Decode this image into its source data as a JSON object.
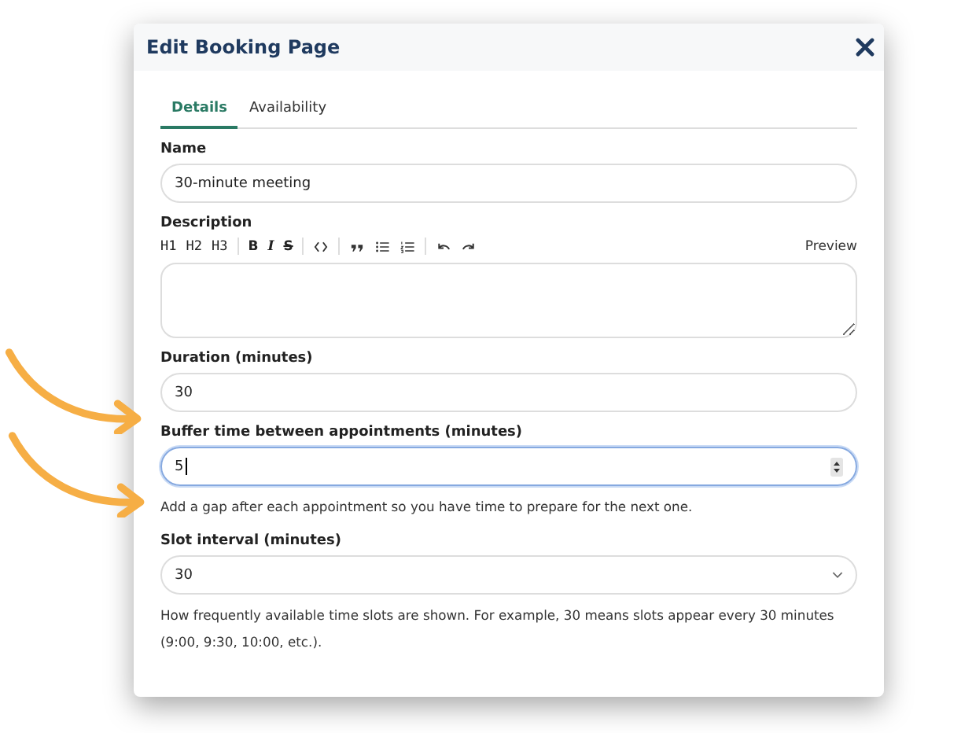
{
  "dialog": {
    "title": "Edit Booking Page"
  },
  "tabs": [
    {
      "label": "Details",
      "selected": true
    },
    {
      "label": "Availability",
      "selected": false
    }
  ],
  "fields": [
    {
      "kind": "text",
      "label": "Name",
      "value": "30-minute meeting",
      "focused": false
    },
    {
      "kind": "editor",
      "label": "Description",
      "preview": "Preview",
      "toolbar": [
        [
          {
            "kind": "text",
            "text": "H1"
          },
          {
            "kind": "text",
            "text": "H2"
          },
          {
            "kind": "text",
            "text": "H3"
          }
        ],
        [
          {
            "kind": "bold",
            "text": "B"
          },
          {
            "kind": "italic",
            "text": "I"
          },
          {
            "kind": "strike",
            "text": "S"
          }
        ],
        [
          {
            "kind": "code"
          }
        ],
        [
          {
            "kind": "quote"
          },
          {
            "kind": "bullets"
          },
          {
            "kind": "numbers"
          }
        ],
        [
          {
            "kind": "undo"
          },
          {
            "kind": "redo"
          }
        ]
      ]
    },
    {
      "kind": "number",
      "label": "Duration (minutes)",
      "value": "30",
      "focused": false
    },
    {
      "kind": "number",
      "label": "Buffer time between appointments (minutes)",
      "value": "5",
      "focused": true,
      "help": "Add a gap after each appointment so you have time to prepare for the next one."
    },
    {
      "kind": "select",
      "label": "Slot interval (minutes)",
      "value": "30",
      "focused": false,
      "help": "How frequently available time slots are shown. For example, 30 means slots appear every 30 minutes (9:00, 9:30, 10:00, etc.)."
    }
  ]
}
